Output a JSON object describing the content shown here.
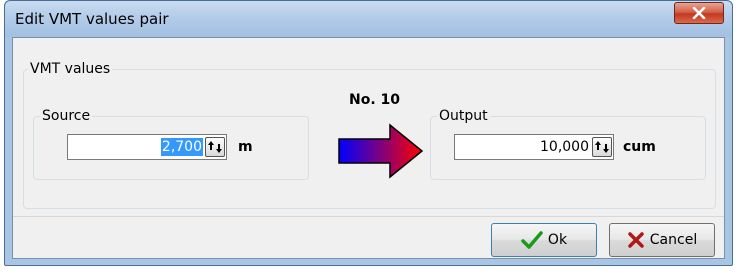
{
  "window": {
    "title": "Edit VMT values pair",
    "close_icon": "close-x-icon"
  },
  "vmt": {
    "group_label": "VMT values",
    "number_label": "No. 10",
    "source": {
      "label": "Source",
      "value": "2,700",
      "unit": "m"
    },
    "output": {
      "label": "Output",
      "value": "10,000",
      "unit": "cum"
    },
    "arrow_icon": "gradient-right-arrow-icon",
    "arrow_colors": [
      "#0000ff",
      "#ff0000"
    ]
  },
  "buttons": {
    "ok_label": "Ok",
    "ok_icon": "checkmark-icon",
    "cancel_label": "Cancel",
    "cancel_icon": "x-cross-icon"
  },
  "colors": {
    "selection": "#3399ff",
    "title_bar": "#a9c5e4",
    "close_button": "#c2391f"
  }
}
